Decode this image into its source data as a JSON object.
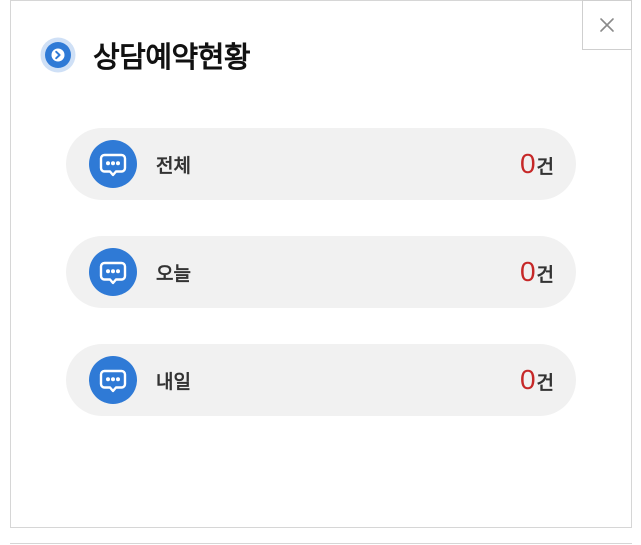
{
  "dialog": {
    "title": "상담예약현황",
    "close_icon": "close-icon",
    "title_icon": "circle-chevron-right-icon"
  },
  "stats": [
    {
      "label": "전체",
      "count": "0",
      "unit": "건",
      "icon": "chat-bubble-icon"
    },
    {
      "label": "오늘",
      "count": "0",
      "unit": "건",
      "icon": "chat-bubble-icon"
    },
    {
      "label": "내일",
      "count": "0",
      "unit": "건",
      "icon": "chat-bubble-icon"
    }
  ],
  "colors": {
    "accent": "#2f7ad6",
    "count": "#c62828",
    "row_background": "#f1f1f1",
    "border": "#d6d6d6"
  }
}
